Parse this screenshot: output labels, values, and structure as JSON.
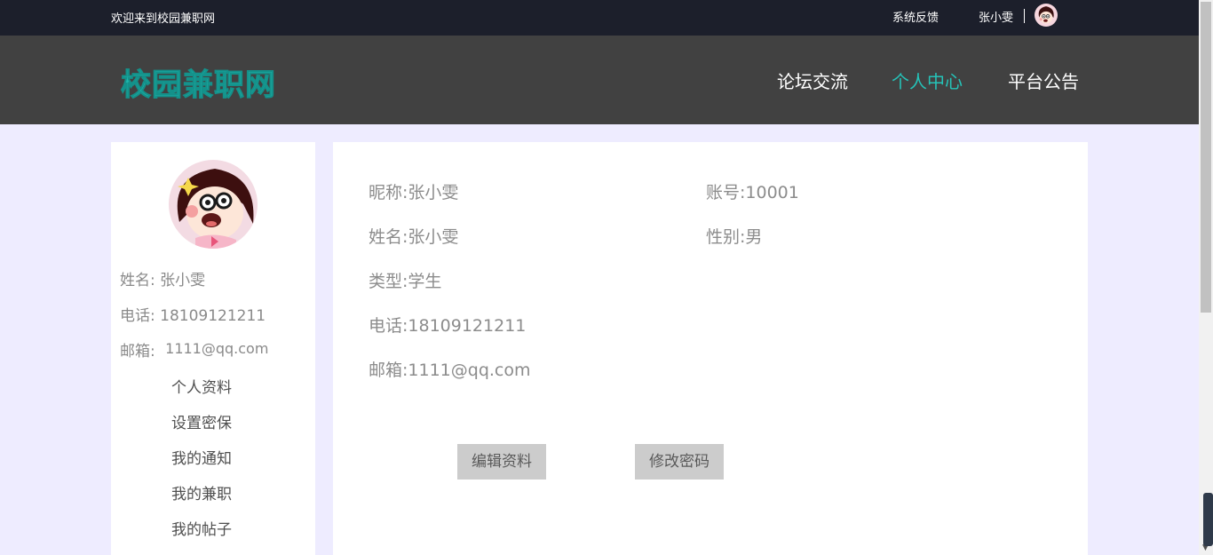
{
  "topbar": {
    "welcome": "欢迎来到校园兼职网",
    "feedback": "系统反馈",
    "username": "张小雯",
    "avatar_icon": "user-avatar-icon"
  },
  "navbar": {
    "logo": "校园兼职网",
    "items": [
      {
        "label": "论坛交流",
        "active": false
      },
      {
        "label": "个人中心",
        "active": true
      },
      {
        "label": "平台公告",
        "active": false
      }
    ],
    "accent_color": "#25c3b8"
  },
  "sidebar": {
    "name_label": "姓名:",
    "name_value": "张小雯",
    "phone_label": "电话:",
    "phone_value": "18109121211",
    "email_label": "邮箱:",
    "email_value": "1111@qq.com",
    "menu": [
      "个人资料",
      "设置密保",
      "我的通知",
      "我的兼职",
      "我的帖子"
    ]
  },
  "profile": {
    "nickname_label": "昵称:",
    "nickname_value": "张小雯",
    "account_label": "账号:",
    "account_value": "10001",
    "realname_label": "姓名:",
    "realname_value": "张小雯",
    "gender_label": "性别:",
    "gender_value": "男",
    "type_label": "类型:",
    "type_value": "学生",
    "phone_label": "电话:",
    "phone_value": "18109121211",
    "email_label": "邮箱:",
    "email_value": "1111@qq.com"
  },
  "actions": {
    "edit_label": "编辑资料",
    "password_label": "修改密码"
  }
}
